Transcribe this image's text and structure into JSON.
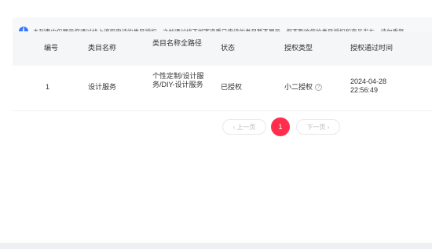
{
  "notice": {
    "text": "本列表中仅展示您通过线上流程申请的类目授权，之前通过线下邮寄资质已申请的类目暂不展示，但不影响您的类目授权和商品发布，请勿重复"
  },
  "table": {
    "headers": [
      "编号",
      "类目名称",
      "类目名称全路径",
      "状态",
      "授权类型",
      "授权通过时间"
    ],
    "rows": [
      {
        "id": "1",
        "name": "设计服务",
        "path": "个性定制/设计服务/DIY-设计服务",
        "status": "已授权",
        "auth_type": "小二授权",
        "time": "2024-04-28 22:56:49"
      }
    ]
  },
  "pagination": {
    "prev_label": "‹ 上一页",
    "next_label": "下一页 ›",
    "current_page": "1"
  },
  "icons": {
    "info": "info-icon",
    "help": "question-circle-icon"
  },
  "colors": {
    "accent": "#ff2e4d",
    "info": "#3377ff"
  }
}
